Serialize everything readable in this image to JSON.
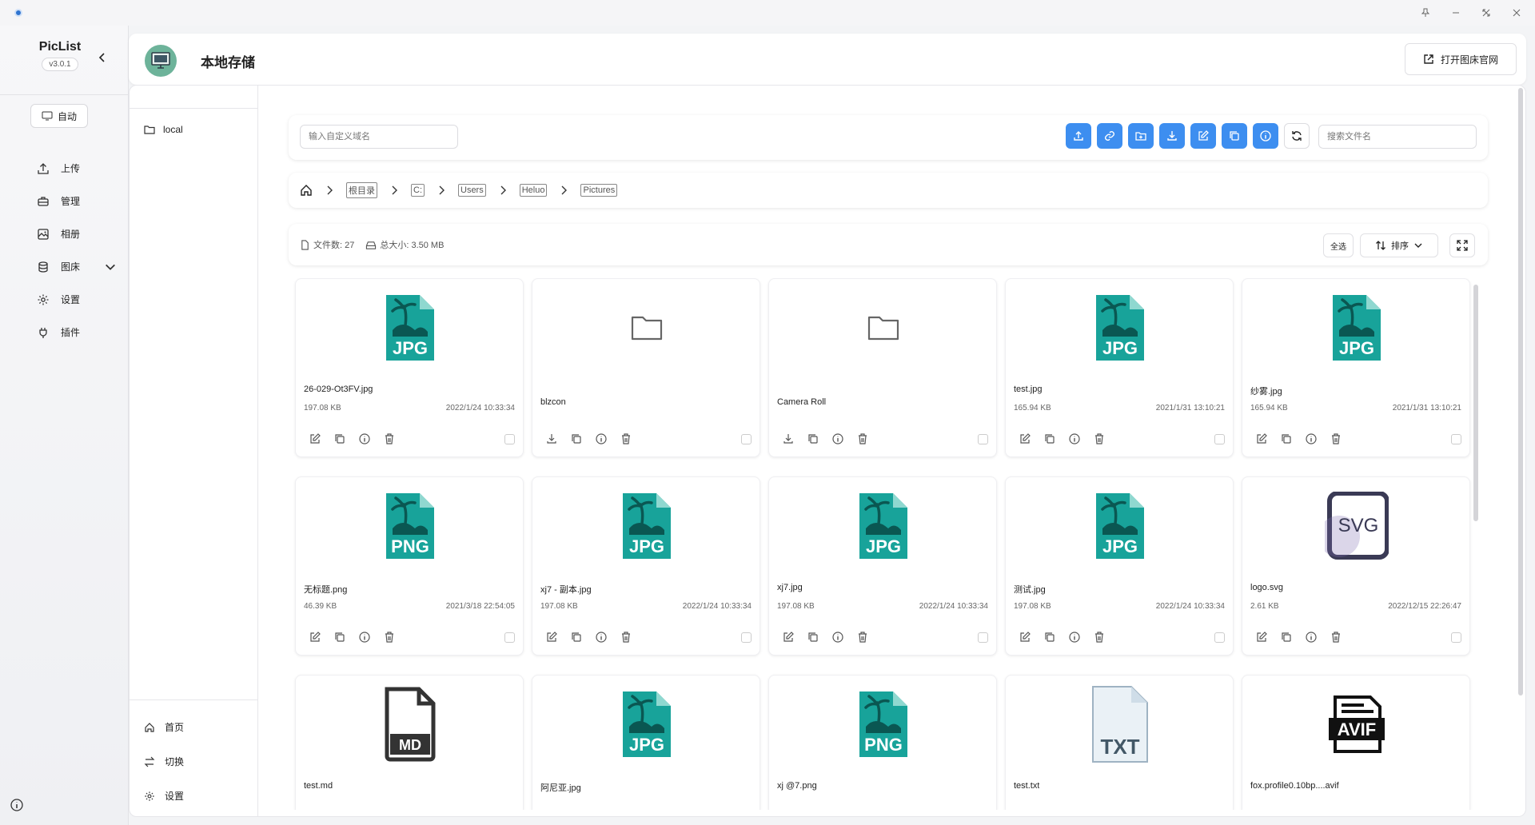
{
  "app": {
    "name": "PicList",
    "version": "v3.0.1"
  },
  "sidebar": {
    "auto_label": "自动",
    "items": [
      {
        "label": "上传",
        "icon": "upload-icon"
      },
      {
        "label": "管理",
        "icon": "briefcase-icon"
      },
      {
        "label": "相册",
        "icon": "gallery-icon"
      },
      {
        "label": "图床",
        "icon": "database-icon"
      },
      {
        "label": "设置",
        "icon": "gear-icon"
      },
      {
        "label": "插件",
        "icon": "plug-icon"
      }
    ]
  },
  "header": {
    "title": "本地存储",
    "open_site_label": "打开图床官网"
  },
  "inner_sidebar": {
    "local_label": "local",
    "bottom_items": [
      {
        "label": "首页",
        "icon": "home-icon"
      },
      {
        "label": "切换",
        "icon": "switch-icon"
      },
      {
        "label": "设置",
        "icon": "gear-icon"
      }
    ]
  },
  "toolbar": {
    "domain_placeholder": "输入自定义域名",
    "search_placeholder": "搜索文件名",
    "accent": "#3d8ef0"
  },
  "breadcrumb": [
    "根目录",
    "C:",
    "Users",
    "Heluo",
    "Pictures"
  ],
  "info": {
    "file_count": "文件数: 27",
    "total_size": "总大小: 3.50 MB",
    "select_all": "全选",
    "sort": "排序"
  },
  "files": [
    {
      "name": "26-029-Ot3FV.jpg",
      "size": "197.08 KB",
      "date": "2022/1/24 10:33:34",
      "type": "JPG"
    },
    {
      "name": "blzcon",
      "size": "",
      "date": "",
      "type": "folder"
    },
    {
      "name": "Camera Roll",
      "size": "",
      "date": "",
      "type": "folder"
    },
    {
      "name": "test.jpg",
      "size": "165.94 KB",
      "date": "2021/1/31 13:10:21",
      "type": "JPG"
    },
    {
      "name": "纱雾.jpg",
      "size": "165.94 KB",
      "date": "2021/1/31 13:10:21",
      "type": "JPG"
    },
    {
      "name": "无标题.png",
      "size": "46.39 KB",
      "date": "2021/3/18 22:54:05",
      "type": "PNG"
    },
    {
      "name": "xj7 - 副本.jpg",
      "size": "197.08 KB",
      "date": "2022/1/24 10:33:34",
      "type": "JPG"
    },
    {
      "name": "xj7.jpg",
      "size": "197.08 KB",
      "date": "2022/1/24 10:33:34",
      "type": "JPG"
    },
    {
      "name": "测试.jpg",
      "size": "197.08 KB",
      "date": "2022/1/24 10:33:34",
      "type": "JPG"
    },
    {
      "name": "logo.svg",
      "size": "2.61 KB",
      "date": "2022/12/15 22:26:47",
      "type": "SVG"
    },
    {
      "name": "test.md",
      "size": "",
      "date": "",
      "type": "MD"
    },
    {
      "name": "阿尼亚.jpg",
      "size": "",
      "date": "",
      "type": "JPG"
    },
    {
      "name": "xj @7.png",
      "size": "",
      "date": "",
      "type": "PNG"
    },
    {
      "name": "test.txt",
      "size": "",
      "date": "",
      "type": "TXT"
    },
    {
      "name": "fox.profile0.10bp....avif",
      "size": "",
      "date": "",
      "type": "AVIF"
    }
  ]
}
